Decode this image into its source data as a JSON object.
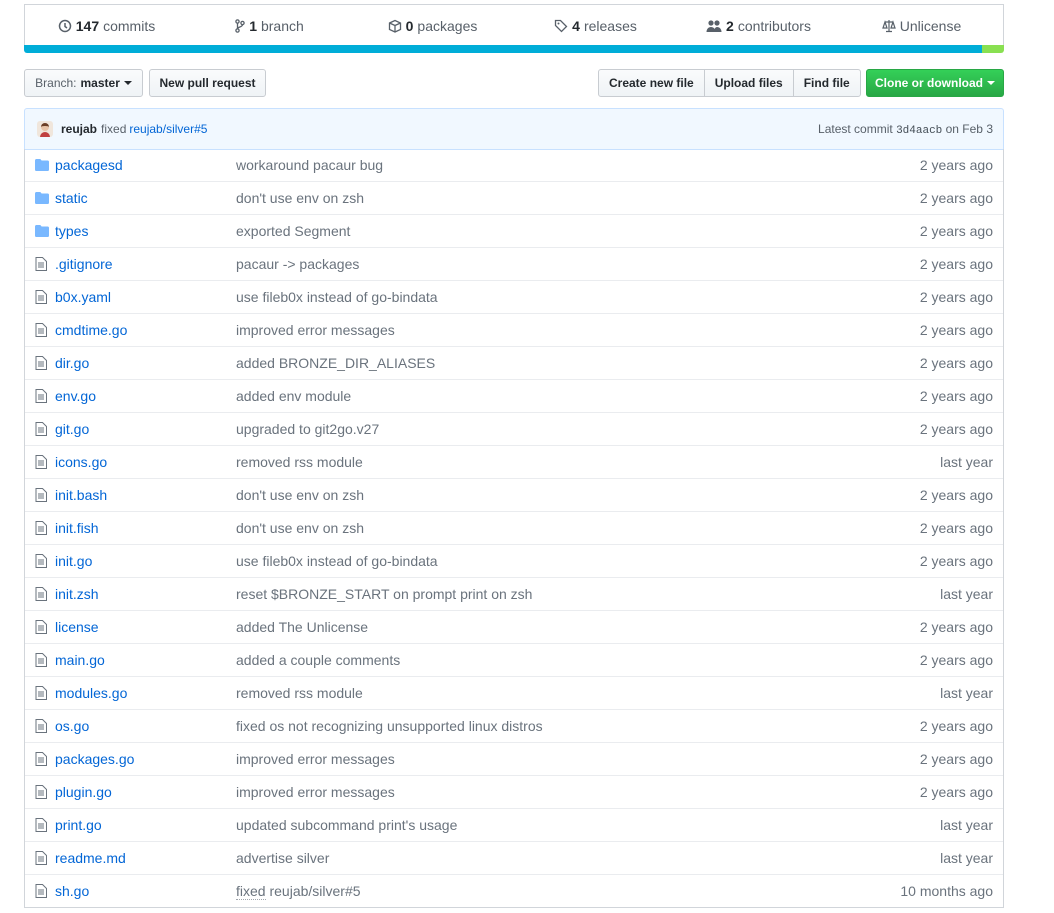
{
  "summary": {
    "commits_count": "147",
    "commits_label": "commits",
    "branch_count": "1",
    "branch_label": "branch",
    "packages_count": "0",
    "packages_label": "packages",
    "releases_count": "4",
    "releases_label": "releases",
    "contributors_count": "2",
    "contributors_label": "contributors",
    "license": "Unlicense"
  },
  "language_bar": [
    {
      "color": "#00add8",
      "share": 0.978
    },
    {
      "color": "#89e051",
      "share": 0.022
    }
  ],
  "controls": {
    "branch_prefix": "Branch:",
    "branch_name": "master",
    "new_pull_request": "New pull request",
    "create_new_file": "Create new file",
    "upload_files": "Upload files",
    "find_file": "Find file",
    "clone_or_download": "Clone or download"
  },
  "latest_commit": {
    "author": "reujab",
    "message_prefix": "fixed",
    "message_link": "reujab/silver#5",
    "label": "Latest commit",
    "sha": "3d4aacb",
    "date": "on Feb 3"
  },
  "files": [
    {
      "type": "dir",
      "name": "packagesd",
      "message": "workaround pacaur bug",
      "age": "2 years ago"
    },
    {
      "type": "dir",
      "name": "static",
      "message": "don't use env on zsh",
      "age": "2 years ago"
    },
    {
      "type": "dir",
      "name": "types",
      "message": "exported Segment",
      "age": "2 years ago"
    },
    {
      "type": "file",
      "name": ".gitignore",
      "message": "pacaur -> packages",
      "age": "2 years ago"
    },
    {
      "type": "file",
      "name": "b0x.yaml",
      "message": "use fileb0x instead of go-bindata",
      "age": "2 years ago"
    },
    {
      "type": "file",
      "name": "cmdtime.go",
      "message": "improved error messages",
      "age": "2 years ago"
    },
    {
      "type": "file",
      "name": "dir.go",
      "message": "added BRONZE_DIR_ALIASES",
      "age": "2 years ago"
    },
    {
      "type": "file",
      "name": "env.go",
      "message": "added env module",
      "age": "2 years ago"
    },
    {
      "type": "file",
      "name": "git.go",
      "message": "upgraded to git2go.v27",
      "age": "2 years ago"
    },
    {
      "type": "file",
      "name": "icons.go",
      "message": "removed rss module",
      "age": "last year"
    },
    {
      "type": "file",
      "name": "init.bash",
      "message": "don't use env on zsh",
      "age": "2 years ago"
    },
    {
      "type": "file",
      "name": "init.fish",
      "message": "don't use env on zsh",
      "age": "2 years ago"
    },
    {
      "type": "file",
      "name": "init.go",
      "message": "use fileb0x instead of go-bindata",
      "age": "2 years ago"
    },
    {
      "type": "file",
      "name": "init.zsh",
      "message": "reset $BRONZE_START on prompt print on zsh",
      "age": "last year"
    },
    {
      "type": "file",
      "name": "license",
      "message": "added The Unlicense",
      "age": "2 years ago"
    },
    {
      "type": "file",
      "name": "main.go",
      "message": "added a couple comments",
      "age": "2 years ago"
    },
    {
      "type": "file",
      "name": "modules.go",
      "message": "removed rss module",
      "age": "last year"
    },
    {
      "type": "file",
      "name": "os.go",
      "message": "fixed os not recognizing unsupported linux distros",
      "age": "2 years ago"
    },
    {
      "type": "file",
      "name": "packages.go",
      "message": "improved error messages",
      "age": "2 years ago"
    },
    {
      "type": "file",
      "name": "plugin.go",
      "message": "improved error messages",
      "age": "2 years ago"
    },
    {
      "type": "file",
      "name": "print.go",
      "message": "updated subcommand print's usage",
      "age": "last year"
    },
    {
      "type": "file",
      "name": "readme.md",
      "message": "advertise silver",
      "age": "last year"
    },
    {
      "type": "file",
      "name": "sh.go",
      "message_prefix": "fixed",
      "message_link": "reujab/silver#5",
      "age": "10 months ago"
    }
  ]
}
